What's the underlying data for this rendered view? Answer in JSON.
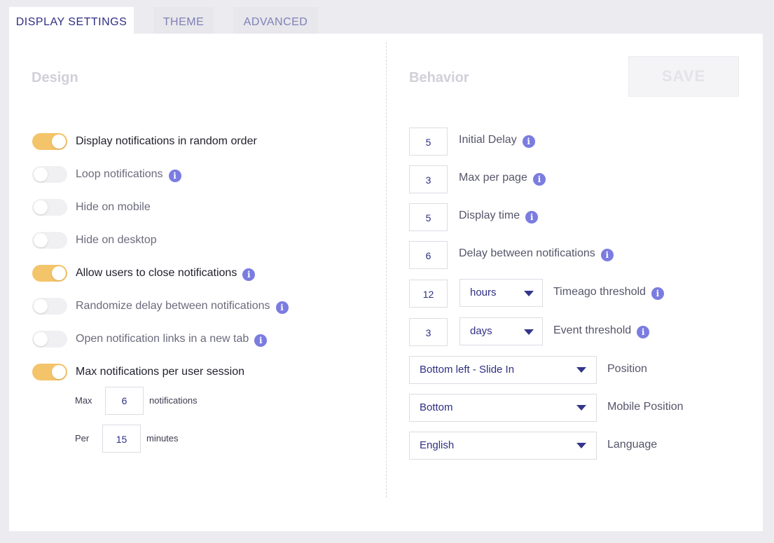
{
  "tabs": [
    {
      "label": "DISPLAY SETTINGS"
    },
    {
      "label": "THEME"
    },
    {
      "label": "ADVANCED"
    }
  ],
  "design": {
    "title": "Design",
    "toggles": [
      {
        "label": "Display notifications in random order",
        "on": true
      },
      {
        "label": "Loop notifications",
        "on": false
      },
      {
        "label": "Hide on mobile",
        "on": false
      },
      {
        "label": "Hide on desktop",
        "on": false
      },
      {
        "label": "Allow users to close notifications",
        "on": true
      },
      {
        "label": "Randomize delay between notifications",
        "on": false
      },
      {
        "label": "Open notification links in a new tab",
        "on": false
      },
      {
        "label": "Max notifications per user session",
        "on": true
      }
    ],
    "session": {
      "max_label": "Max",
      "max_value": "6",
      "max_unit": "notifications",
      "per_label": "Per",
      "per_value": "15",
      "per_unit": "minutes"
    }
  },
  "behavior": {
    "title": "Behavior",
    "save_label": "SAVE",
    "initial_delay": {
      "value": "5",
      "label": "Initial Delay"
    },
    "max_per_page": {
      "value": "3",
      "label": "Max per page"
    },
    "display_time": {
      "value": "5",
      "label": "Display time"
    },
    "delay_between": {
      "value": "6",
      "label": "Delay between notifications"
    },
    "timeago": {
      "value": "12",
      "unit": "hours",
      "label": "Timeago threshold"
    },
    "event": {
      "value": "3",
      "unit": "days",
      "label": "Event threshold"
    },
    "position": {
      "value": "Bottom left - Slide In",
      "label": "Position"
    },
    "mobile_position": {
      "value": "Bottom",
      "label": "Mobile Position"
    },
    "language": {
      "value": "English",
      "label": "Language"
    }
  },
  "info_glyph": "i",
  "colors": {
    "accent": "#2e2f84",
    "toggle_on": "#f4c46a",
    "info": "#7b7ce0"
  }
}
